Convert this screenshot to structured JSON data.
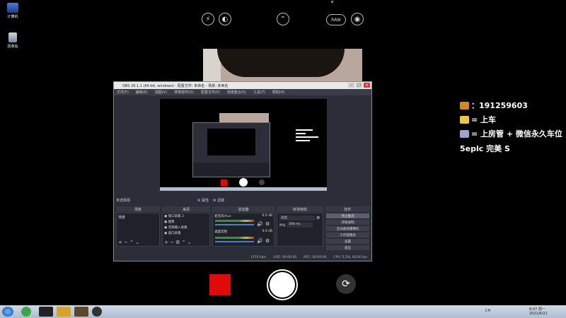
{
  "desktop": {
    "icons": [
      {
        "label": "计算机"
      },
      {
        "label": "回收站"
      }
    ]
  },
  "camera": {
    "top_controls": {
      "flash": "⚡",
      "hdr": "◐",
      "expand": "⌃",
      "raw": "RAW",
      "live": "◉"
    },
    "flip_icon": "⟳"
  },
  "obs": {
    "title": "OBS 26.1.1 (64-bit, windows) - 配置文件: 未命名 - 场景: 未命名",
    "menu": [
      "文件(F)",
      "编辑(E)",
      "视图(V)",
      "停靠部件(D)",
      "配置文件(P)",
      "场景集合(S)",
      "工具(T)",
      "帮助(H)"
    ],
    "source_selected": "未选择源",
    "props_btn": "属性",
    "filters_btn": "滤镜",
    "docks": {
      "scenes": {
        "title": "场景",
        "items": [
          "场景"
        ]
      },
      "sources": {
        "title": "来源",
        "items": [
          "窗口采集 2",
          "图像",
          "音频输入采集",
          "窗口采集"
        ]
      },
      "mixer": {
        "title": "混音器",
        "channels": [
          {
            "name": "桌面音频",
            "db": "0.0 dB"
          },
          {
            "name": "麦克风/Aux",
            "db": "0.0 dB"
          }
        ]
      },
      "transitions": {
        "title": "转场特效",
        "type": "淡出",
        "duration_label": "时长",
        "duration": "300 ms"
      },
      "controls": {
        "title": "控件",
        "buttons": [
          "停止推流",
          "开始录制",
          "启动虚拟摄像机",
          "工作室模式",
          "设置",
          "退出"
        ]
      }
    },
    "status": {
      "live": "LIVE: 00:00:00",
      "rec": "REC: 00:00:00",
      "cpu": "CPU: 5.2%, 60.00 fps",
      "kb": "1270 kb/s"
    }
  },
  "overlay": {
    "lines": [
      {
        "icon_color": "#c98a2a",
        "text": "：191259603"
      },
      {
        "icon_color": "#e7c64a",
        "text": "= 上车"
      },
      {
        "icon_color": "#9aa6c8",
        "text": "= 上房管 + 微信永久车位"
      },
      {
        "icon_color": "",
        "text": "5eplc 完美 S"
      }
    ]
  },
  "taskbar": {
    "lang": "CH",
    "time": "8:07 周一",
    "date": "2021/6/21"
  }
}
